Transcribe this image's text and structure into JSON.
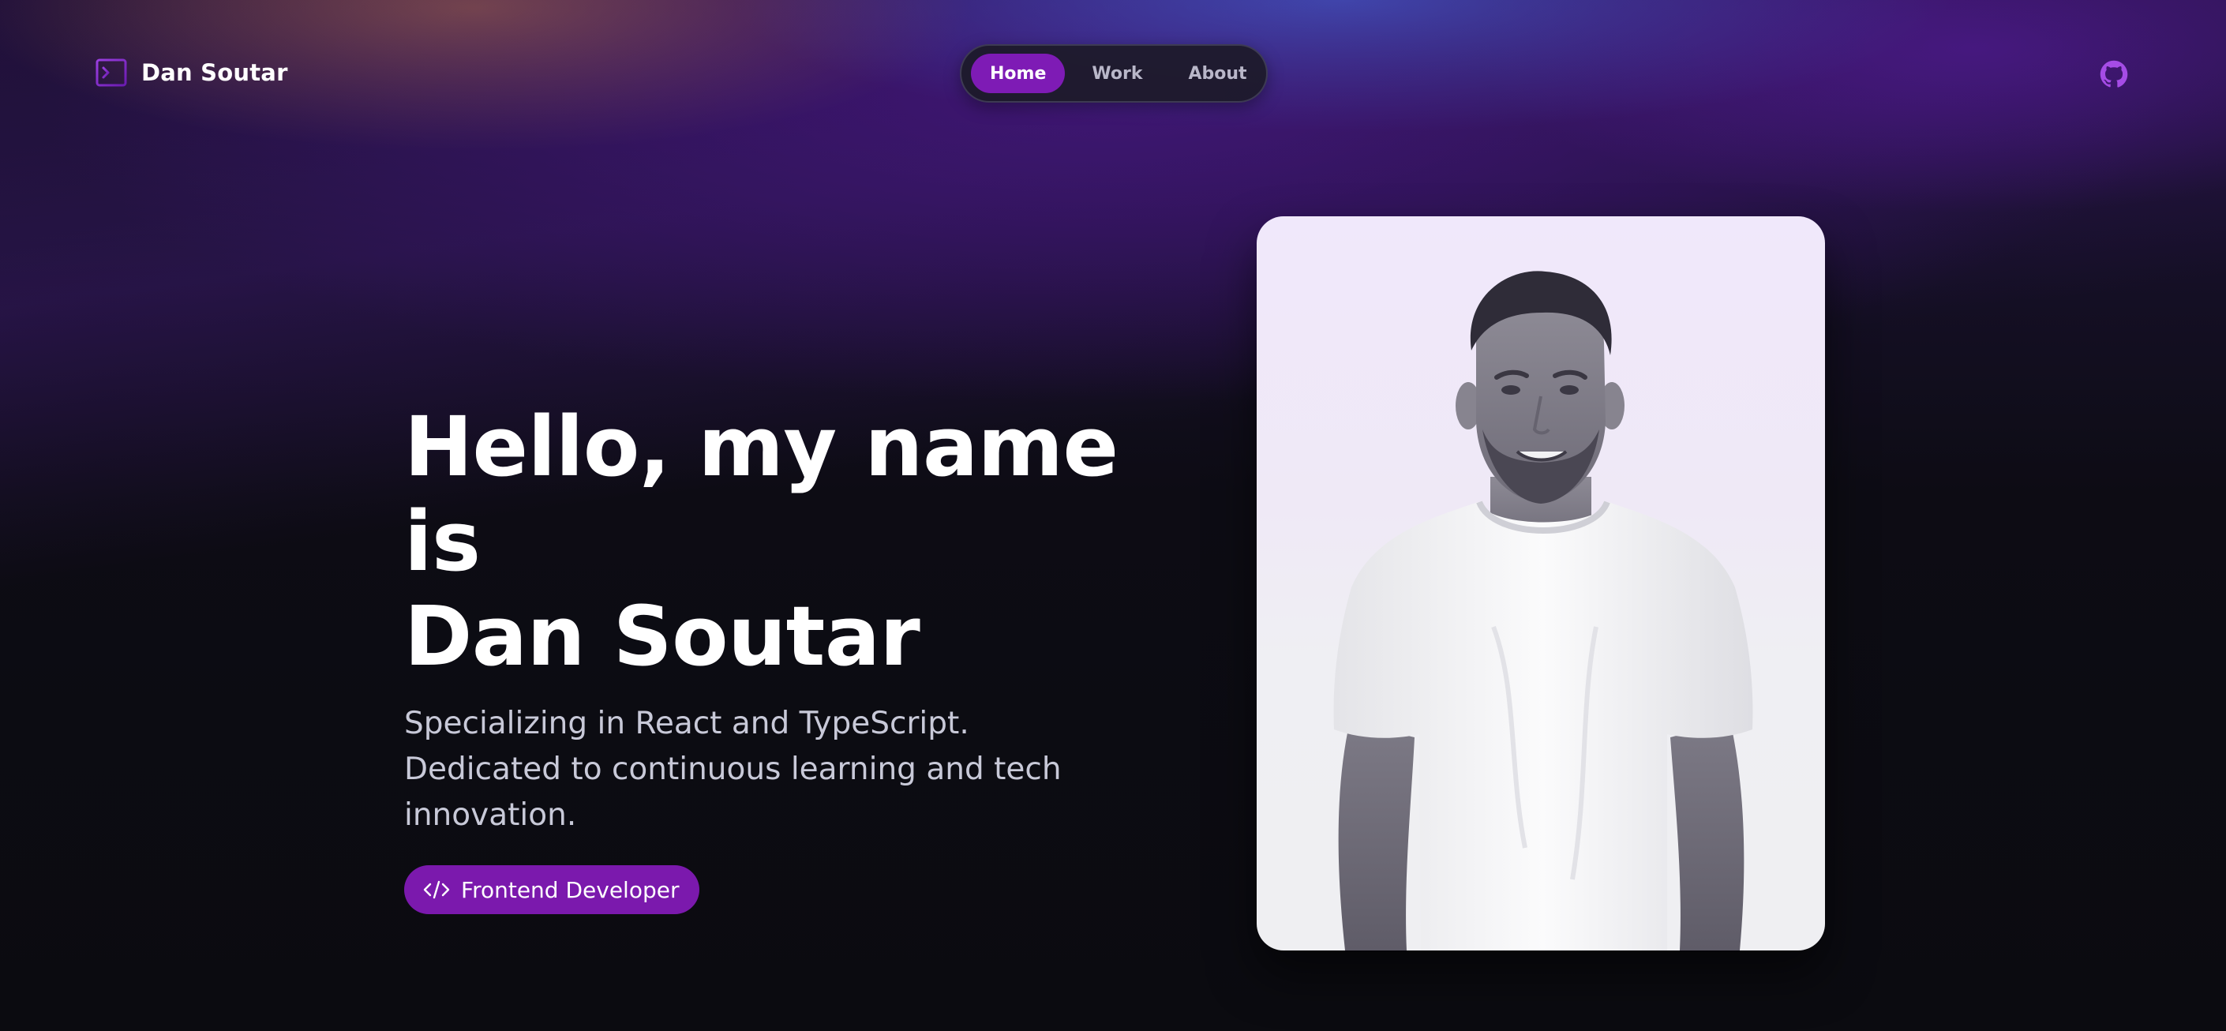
{
  "header": {
    "brand_name": "Dan Soutar",
    "brand_icon": "terminal-icon",
    "nav": [
      {
        "label": "Home",
        "active": true
      },
      {
        "label": "Work",
        "active": false
      },
      {
        "label": "About",
        "active": false
      }
    ],
    "github_icon": "github-icon"
  },
  "hero": {
    "title_line1": "Hello, my name is",
    "title_line2": "Dan Soutar",
    "subtitle": "Specializing in React and TypeScript. Dedicated to continuous learning and tech innovation.",
    "badge_label": "Frontend Developer",
    "badge_icon": "code-icon"
  },
  "profile_photo": {
    "icon": "portrait-photo"
  },
  "colors": {
    "accent": "#7e1bb5",
    "background": "#0b0b10",
    "text": "#ffffff",
    "muted_text": "#c8c9d8"
  }
}
